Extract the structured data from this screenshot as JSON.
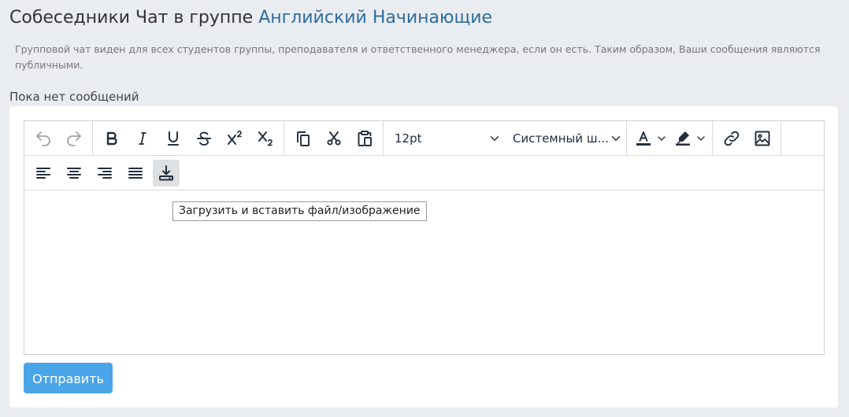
{
  "header": {
    "title_prefix": "Собеседники Чат в группе",
    "group_name": "Английский Начинающие"
  },
  "info": {
    "text": "Групповой чат виден для всех студентов группы, преподавателя и ответственного менеджера, если он есть. Таким образом, Ваши сообщения являются публичными."
  },
  "messages": {
    "empty_text": "Пока нет сообщений"
  },
  "editor": {
    "toolbar": {
      "buttons": [
        {
          "name": "undo-button",
          "icon": "undo-icon",
          "enabled": false
        },
        {
          "name": "redo-button",
          "icon": "redo-icon",
          "enabled": false
        },
        {
          "name": "bold-button",
          "icon": "bold-icon"
        },
        {
          "name": "italic-button",
          "icon": "italic-icon"
        },
        {
          "name": "underline-button",
          "icon": "underline-icon"
        },
        {
          "name": "strikethrough-button",
          "icon": "strikethrough-icon"
        },
        {
          "name": "superscript-button",
          "icon": "superscript-icon"
        },
        {
          "name": "subscript-button",
          "icon": "subscript-icon"
        },
        {
          "name": "copy-button",
          "icon": "copy-icon"
        },
        {
          "name": "cut-button",
          "icon": "scissors-icon"
        },
        {
          "name": "paste-button",
          "icon": "clipboard-icon"
        },
        {
          "name": "text-color-button",
          "icon": "text-color-icon"
        },
        {
          "name": "highlight-color-button",
          "icon": "highlighter-icon"
        },
        {
          "name": "link-button",
          "icon": "link-icon"
        },
        {
          "name": "image-button",
          "icon": "image-icon"
        },
        {
          "name": "align-left-button",
          "icon": "align-left-icon"
        },
        {
          "name": "align-center-button",
          "icon": "align-center-icon"
        },
        {
          "name": "align-right-button",
          "icon": "align-right-icon"
        },
        {
          "name": "align-justify-button",
          "icon": "align-justify-icon"
        },
        {
          "name": "upload-insert-button",
          "icon": "upload-icon",
          "active": true
        }
      ],
      "font_size": "12pt",
      "font_family": "Системный ш..."
    },
    "tooltip": "Загрузить и вставить файл/изображение"
  },
  "actions": {
    "send_label": "Отправить"
  },
  "colors": {
    "accent_link": "#2d6d9c",
    "send_button": "#4aa5e8",
    "background": "#e9ecf1"
  }
}
